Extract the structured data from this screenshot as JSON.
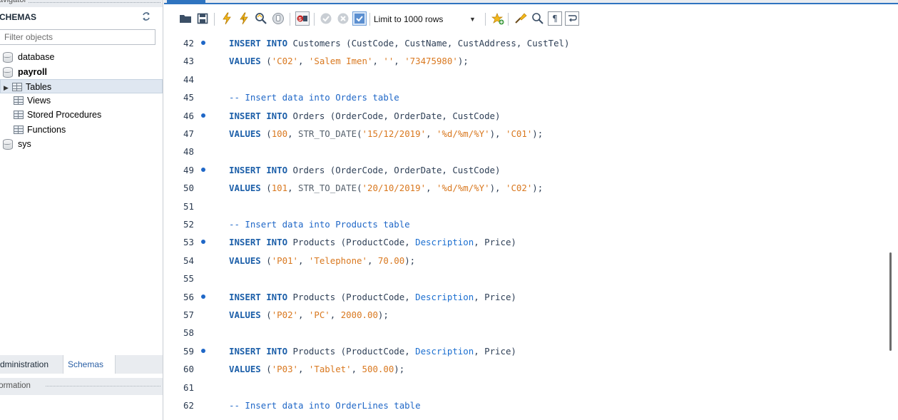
{
  "navigator": {
    "schemas_label": "CHEMAS",
    "filter_placeholder": "Filter objects",
    "tree": [
      {
        "label": "database",
        "type": "schema"
      },
      {
        "label": "payroll",
        "type": "schema",
        "bold": true
      },
      {
        "label": "Tables",
        "type": "folder",
        "selected": true
      },
      {
        "label": "Views",
        "type": "folder"
      },
      {
        "label": "Stored Procedures",
        "type": "folder"
      },
      {
        "label": "Functions",
        "type": "folder"
      },
      {
        "label": "sys",
        "type": "schema"
      }
    ],
    "tabs": [
      {
        "label": "dministration"
      },
      {
        "label": "Schemas",
        "active": true
      }
    ],
    "information_label": "formation"
  },
  "toolbar": {
    "limit_label": "Limit to 1000 rows"
  },
  "editor": {
    "lines": [
      {
        "num": "42",
        "bullet": true,
        "tokens": [
          [
            "kw",
            "INSERT INTO"
          ],
          [
            "id",
            " Customers "
          ],
          [
            "pn",
            "("
          ],
          [
            "id",
            "CustCode, CustName, CustAddress, CustTel"
          ],
          [
            "pn",
            ")"
          ]
        ]
      },
      {
        "num": "43",
        "bullet": false,
        "tokens": [
          [
            "kw",
            "VALUES"
          ],
          [
            "pn",
            " ("
          ],
          [
            "str",
            "'C02'"
          ],
          [
            "pn",
            ", "
          ],
          [
            "str",
            "'Salem Imen'"
          ],
          [
            "pn",
            ", "
          ],
          [
            "str",
            "''"
          ],
          [
            "pn",
            ", "
          ],
          [
            "str",
            "'73475980'"
          ],
          [
            "pn",
            ");"
          ]
        ]
      },
      {
        "num": "44",
        "bullet": false,
        "tokens": []
      },
      {
        "num": "45",
        "bullet": false,
        "tokens": [
          [
            "cmt",
            "-- Insert data into Orders table"
          ]
        ]
      },
      {
        "num": "46",
        "bullet": true,
        "tokens": [
          [
            "kw",
            "INSERT INTO"
          ],
          [
            "id",
            " Orders "
          ],
          [
            "pn",
            "("
          ],
          [
            "id",
            "OrderCode, OrderDate, CustCode"
          ],
          [
            "pn",
            ")"
          ]
        ]
      },
      {
        "num": "47",
        "bullet": false,
        "tokens": [
          [
            "kw",
            "VALUES"
          ],
          [
            "pn",
            " ("
          ],
          [
            "num",
            "100"
          ],
          [
            "pn",
            ", "
          ],
          [
            "fn",
            "STR_TO_DATE"
          ],
          [
            "pn",
            "("
          ],
          [
            "str",
            "'15/12/2019'"
          ],
          [
            "pn",
            ", "
          ],
          [
            "str",
            "'%d/%m/%Y'"
          ],
          [
            "pn",
            "), "
          ],
          [
            "str",
            "'C01'"
          ],
          [
            "pn",
            ");"
          ]
        ]
      },
      {
        "num": "48",
        "bullet": false,
        "tokens": []
      },
      {
        "num": "49",
        "bullet": true,
        "tokens": [
          [
            "kw",
            "INSERT INTO"
          ],
          [
            "id",
            " Orders "
          ],
          [
            "pn",
            "("
          ],
          [
            "id",
            "OrderCode, OrderDate, CustCode"
          ],
          [
            "pn",
            ")"
          ]
        ]
      },
      {
        "num": "50",
        "bullet": false,
        "tokens": [
          [
            "kw",
            "VALUES"
          ],
          [
            "pn",
            " ("
          ],
          [
            "num",
            "101"
          ],
          [
            "pn",
            ", "
          ],
          [
            "fn",
            "STR_TO_DATE"
          ],
          [
            "pn",
            "("
          ],
          [
            "str",
            "'20/10/2019'"
          ],
          [
            "pn",
            ", "
          ],
          [
            "str",
            "'%d/%m/%Y'"
          ],
          [
            "pn",
            "), "
          ],
          [
            "str",
            "'C02'"
          ],
          [
            "pn",
            ");"
          ]
        ]
      },
      {
        "num": "51",
        "bullet": false,
        "tokens": []
      },
      {
        "num": "52",
        "bullet": false,
        "tokens": [
          [
            "cmt",
            "-- Insert data into Products table"
          ]
        ]
      },
      {
        "num": "53",
        "bullet": true,
        "tokens": [
          [
            "kw",
            "INSERT INTO"
          ],
          [
            "id",
            " Products "
          ],
          [
            "pn",
            "("
          ],
          [
            "id",
            "ProductCode, "
          ],
          [
            "col",
            "Description"
          ],
          [
            "id",
            ", Price"
          ],
          [
            "pn",
            ")"
          ]
        ]
      },
      {
        "num": "54",
        "bullet": false,
        "tokens": [
          [
            "kw",
            "VALUES"
          ],
          [
            "pn",
            " ("
          ],
          [
            "str",
            "'P01'"
          ],
          [
            "pn",
            ", "
          ],
          [
            "str",
            "'Telephone'"
          ],
          [
            "pn",
            ", "
          ],
          [
            "num",
            "70.00"
          ],
          [
            "pn",
            ");"
          ]
        ]
      },
      {
        "num": "55",
        "bullet": false,
        "tokens": []
      },
      {
        "num": "56",
        "bullet": true,
        "tokens": [
          [
            "kw",
            "INSERT INTO"
          ],
          [
            "id",
            " Products "
          ],
          [
            "pn",
            "("
          ],
          [
            "id",
            "ProductCode, "
          ],
          [
            "col",
            "Description"
          ],
          [
            "id",
            ", Price"
          ],
          [
            "pn",
            ")"
          ]
        ]
      },
      {
        "num": "57",
        "bullet": false,
        "tokens": [
          [
            "kw",
            "VALUES"
          ],
          [
            "pn",
            " ("
          ],
          [
            "str",
            "'P02'"
          ],
          [
            "pn",
            ", "
          ],
          [
            "str",
            "'PC'"
          ],
          [
            "pn",
            ", "
          ],
          [
            "num",
            "2000.00"
          ],
          [
            "pn",
            ");"
          ]
        ]
      },
      {
        "num": "58",
        "bullet": false,
        "tokens": []
      },
      {
        "num": "59",
        "bullet": true,
        "tokens": [
          [
            "kw",
            "INSERT INTO"
          ],
          [
            "id",
            " Products "
          ],
          [
            "pn",
            "("
          ],
          [
            "id",
            "ProductCode, "
          ],
          [
            "col",
            "Description"
          ],
          [
            "id",
            ", Price"
          ],
          [
            "pn",
            ")"
          ]
        ]
      },
      {
        "num": "60",
        "bullet": false,
        "tokens": [
          [
            "kw",
            "VALUES"
          ],
          [
            "pn",
            " ("
          ],
          [
            "str",
            "'P03'"
          ],
          [
            "pn",
            ", "
          ],
          [
            "str",
            "'Tablet'"
          ],
          [
            "pn",
            ", "
          ],
          [
            "num",
            "500.00"
          ],
          [
            "pn",
            ");"
          ]
        ]
      },
      {
        "num": "61",
        "bullet": false,
        "tokens": []
      },
      {
        "num": "62",
        "bullet": false,
        "tokens": [
          [
            "cmt",
            "-- Insert data into OrderLines table"
          ]
        ]
      }
    ]
  },
  "colors": {
    "keyword": "#1c5fa9",
    "string": "#d9781f",
    "comment": "#1f67c7",
    "accent": "#2f74c0"
  },
  "icons": [
    "folder-open-icon",
    "save-icon",
    "execute-icon",
    "execute-current-icon",
    "explain-icon",
    "stop-icon",
    "toggle-error-stop-icon",
    "commit-icon",
    "rollback-icon",
    "autocommit-icon",
    "add-snippet-icon",
    "beautify-icon",
    "find-icon",
    "invisible-chars-icon",
    "wrap-icon",
    "refresh-icon"
  ]
}
